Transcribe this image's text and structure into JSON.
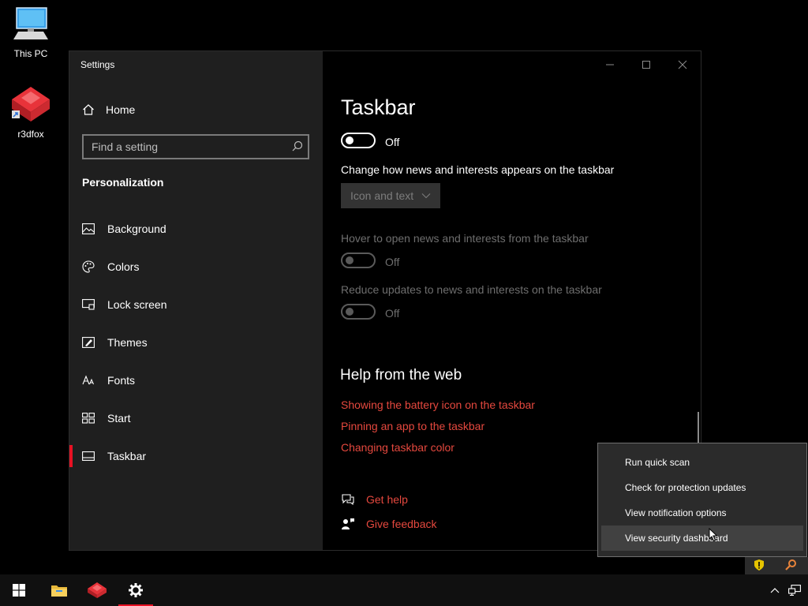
{
  "desktop": {
    "icons": [
      {
        "label": "This PC"
      },
      {
        "label": "r3dfox"
      }
    ]
  },
  "window": {
    "title": "Settings",
    "sidebar": {
      "home_label": "Home",
      "search_placeholder": "Find a setting",
      "section_title": "Personalization",
      "items": [
        {
          "label": "Background",
          "icon": "image-icon"
        },
        {
          "label": "Colors",
          "icon": "palette-icon"
        },
        {
          "label": "Lock screen",
          "icon": "lock-screen-icon"
        },
        {
          "label": "Themes",
          "icon": "themes-icon"
        },
        {
          "label": "Fonts",
          "icon": "fonts-icon"
        },
        {
          "label": "Start",
          "icon": "start-icon"
        },
        {
          "label": "Taskbar",
          "icon": "taskbar-icon",
          "active": true
        }
      ]
    },
    "content": {
      "title": "Taskbar",
      "toggle1_state": "Off",
      "news_label": "Change how news and interests appears on the taskbar",
      "news_dropdown_value": "Icon and text",
      "hover_label": "Hover to open news and interests from the taskbar",
      "hover_state": "Off",
      "reduce_label": "Reduce updates to news and interests on the taskbar",
      "reduce_state": "Off",
      "help_title": "Help from the web",
      "help_links": [
        "Showing the battery icon on the taskbar",
        "Pinning an app to the taskbar",
        "Changing taskbar color"
      ],
      "get_help": "Get help",
      "give_feedback": "Give feedback"
    }
  },
  "context_menu": {
    "items": [
      "Run quick scan",
      "Check for protection updates",
      "View notification options",
      "View security dashboard"
    ],
    "hovered_index": 3
  },
  "colors": {
    "accent": "#e81123",
    "link": "#e5483e",
    "sidebar_bg": "#1f1f1f"
  }
}
